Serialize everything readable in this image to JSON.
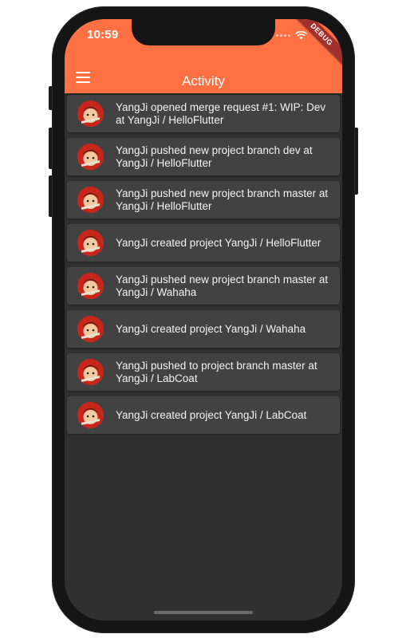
{
  "status_bar": {
    "time": "10:59",
    "debug_label": "DEBUG"
  },
  "app_bar": {
    "title": "Activity",
    "menu_icon": "menu-icon",
    "background_color": "#ff7043"
  },
  "activity_items": [
    {
      "text": "YangJi opened merge request #1: WIP: Dev at YangJi / HelloFlutter",
      "avatar_icon": "user-avatar-icon"
    },
    {
      "text": "YangJi pushed new project branch dev at YangJi / HelloFlutter",
      "avatar_icon": "user-avatar-icon"
    },
    {
      "text": "YangJi pushed new project branch master at YangJi / HelloFlutter",
      "avatar_icon": "user-avatar-icon"
    },
    {
      "text": "YangJi created project YangJi / HelloFlutter",
      "avatar_icon": "user-avatar-icon"
    },
    {
      "text": "YangJi pushed new project branch master at YangJi / Wahaha",
      "avatar_icon": "user-avatar-icon"
    },
    {
      "text": "YangJi created project YangJi / Wahaha",
      "avatar_icon": "user-avatar-icon"
    },
    {
      "text": "YangJi pushed to project branch master at YangJi / LabCoat",
      "avatar_icon": "user-avatar-icon"
    },
    {
      "text": "YangJi created project YangJi / LabCoat",
      "avatar_icon": "user-avatar-icon"
    }
  ],
  "colors": {
    "list_background": "#303030",
    "card_background": "#424242",
    "debug_ribbon": "#a0302d"
  }
}
